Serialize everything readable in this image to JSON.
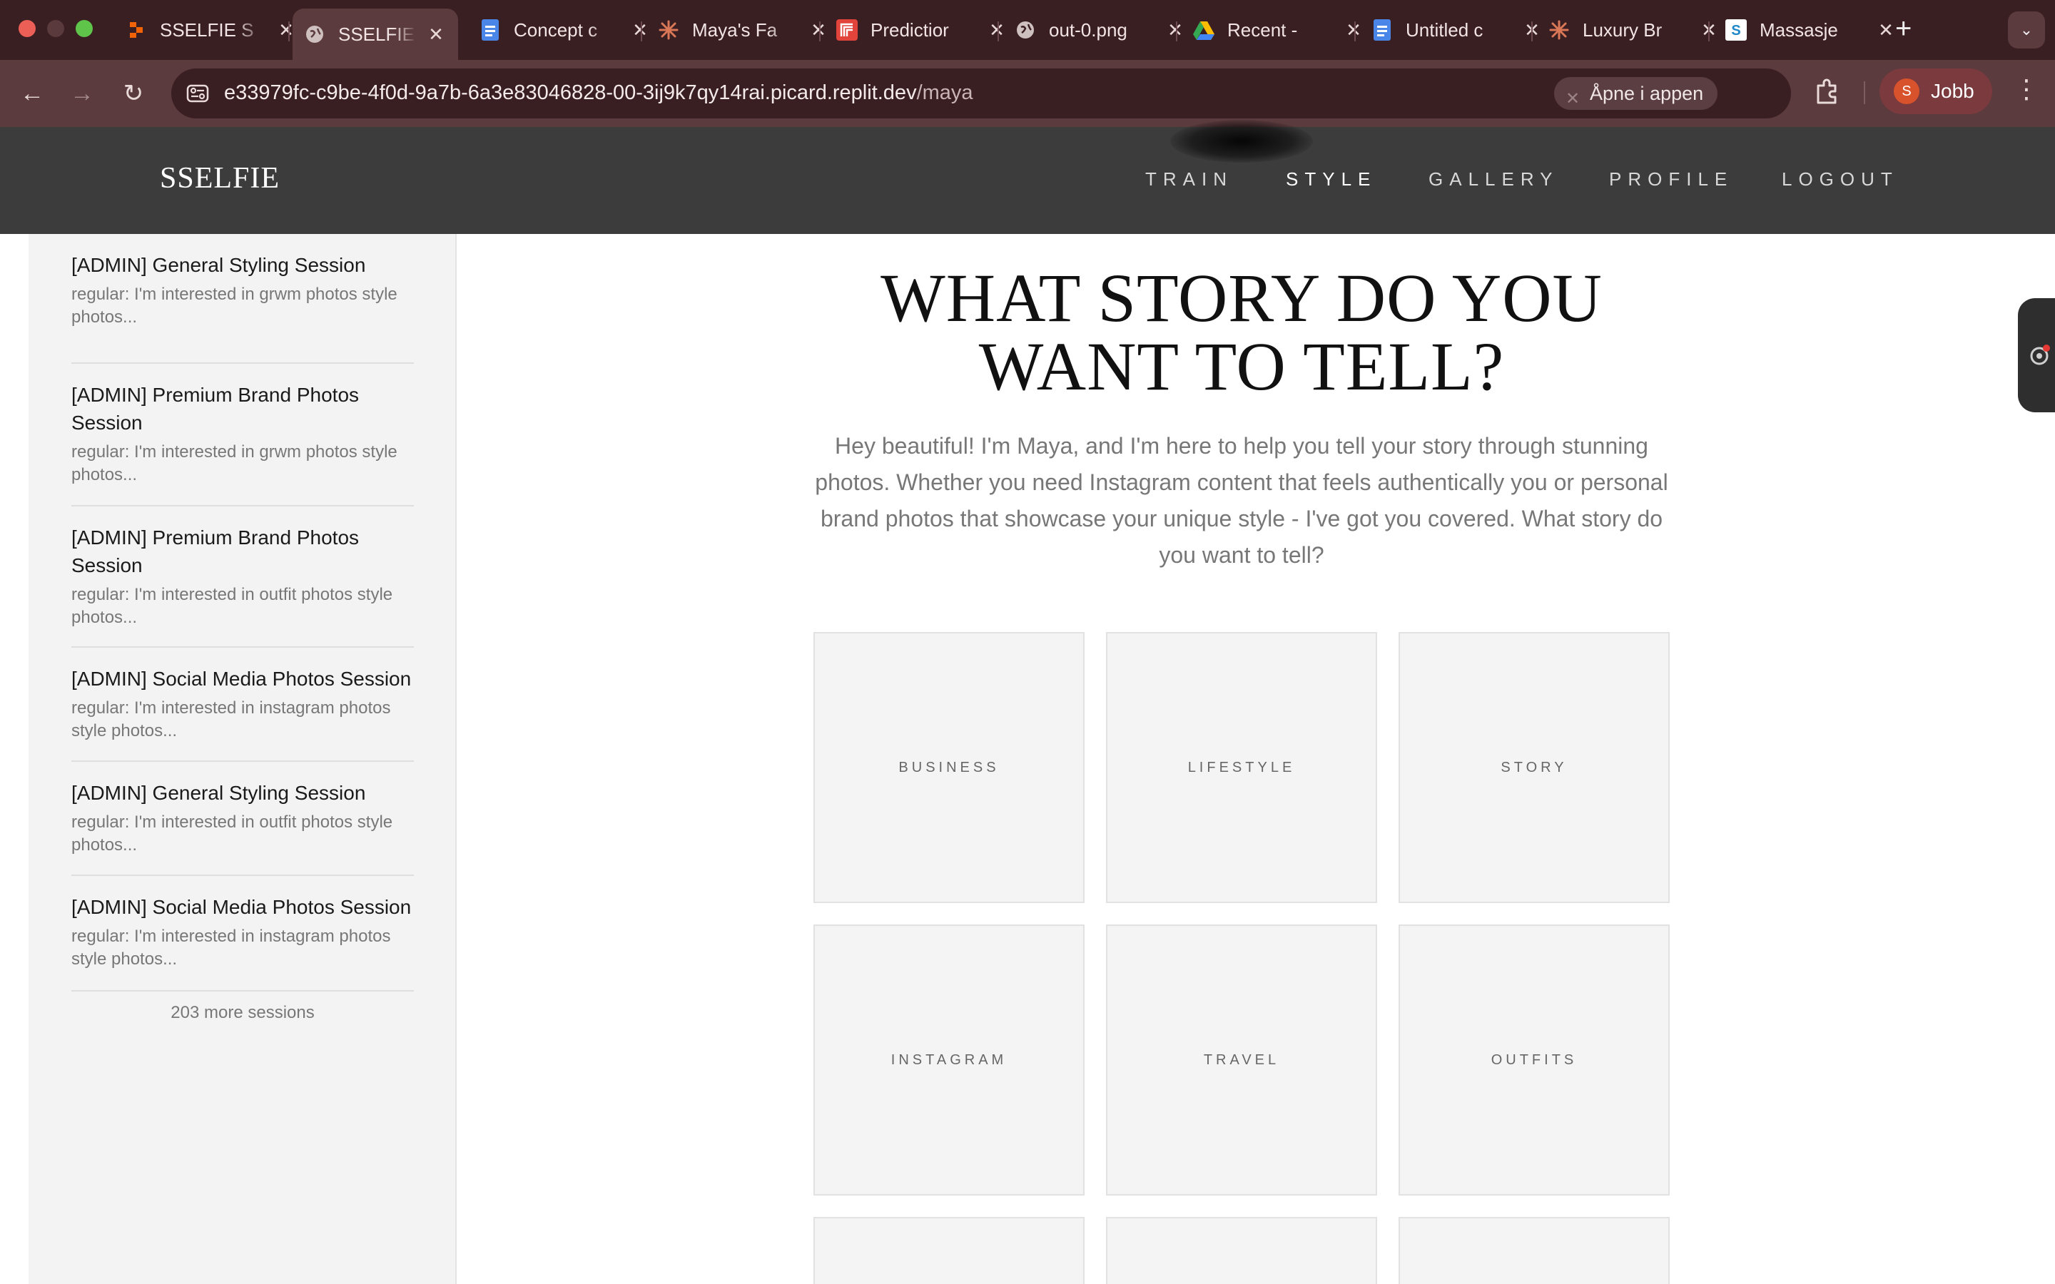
{
  "browser": {
    "tabs": [
      {
        "title": "SSELFIE S",
        "icon": "replit-icon",
        "active": false
      },
      {
        "title": "SSELFIE S",
        "icon": "globe-icon",
        "active": true
      },
      {
        "title": "Concept c",
        "icon": "docs-icon",
        "active": false
      },
      {
        "title": "Maya's Fa",
        "icon": "claude-icon",
        "active": false
      },
      {
        "title": "Predictior",
        "icon": "replicate-icon",
        "active": false
      },
      {
        "title": "out-0.png",
        "icon": "globe-icon",
        "active": false
      },
      {
        "title": "Recent -",
        "icon": "drive-icon",
        "active": false
      },
      {
        "title": "Untitled c",
        "icon": "docs-icon",
        "active": false
      },
      {
        "title": "Luxury Br",
        "icon": "claude-icon",
        "active": false
      },
      {
        "title": "Massasje",
        "icon": "s-logo-icon",
        "active": false
      }
    ],
    "url_main": "e33979fc-c9be-4f0d-9a7b-6a3e83046828-00-3ij9k7qy14rai.picard.replit.dev",
    "url_path": "/maya",
    "open_in_app": "Åpne i appen",
    "profile_initial": "S",
    "profile_name": "Jobb"
  },
  "site": {
    "logo": "SSELFIE",
    "nav": [
      {
        "label": "TRAIN",
        "active": false
      },
      {
        "label": "STYLE",
        "active": true
      },
      {
        "label": "GALLERY",
        "active": false
      },
      {
        "label": "PROFILE",
        "active": false
      },
      {
        "label": "LOGOUT",
        "active": false
      }
    ]
  },
  "sidebar": {
    "sessions": [
      {
        "title": "[ADMIN] General Styling Session",
        "desc": "regular: I'm interested in grwm photos style photos..."
      },
      {
        "title": "[ADMIN] Premium Brand Photos Session",
        "desc": "regular: I'm interested in grwm photos style photos..."
      },
      {
        "title": "[ADMIN] Premium Brand Photos Session",
        "desc": "regular: I'm interested in outfit photos style photos..."
      },
      {
        "title": "[ADMIN] Social Media Photos Session",
        "desc": "regular: I'm interested in instagram photos style photos..."
      },
      {
        "title": "[ADMIN] General Styling Session",
        "desc": "regular: I'm interested in outfit photos style photos..."
      },
      {
        "title": "[ADMIN] Social Media Photos Session",
        "desc": "regular: I'm interested in instagram photos style photos..."
      }
    ],
    "more": "203 more sessions"
  },
  "main": {
    "title_line1": "WHAT STORY DO YOU",
    "title_line2": "WANT TO TELL?",
    "intro": "Hey beautiful! I'm Maya, and I'm here to help you tell your story through stunning photos. Whether you need Instagram content that feels authentically you or personal brand photos that showcase your unique style - I've got you covered. What story do you want to tell?",
    "categories": [
      "BUSINESS",
      "LIFESTYLE",
      "STORY",
      "INSTAGRAM",
      "TRAVEL",
      "OUTFITS"
    ]
  },
  "colors": {
    "tabbar": "#3a1f22",
    "toolbar": "#5b3b3e",
    "site_header": "#3c3c3c",
    "sidebar_bg": "#f3f3f3",
    "tile_bg": "#f4f4f4"
  }
}
